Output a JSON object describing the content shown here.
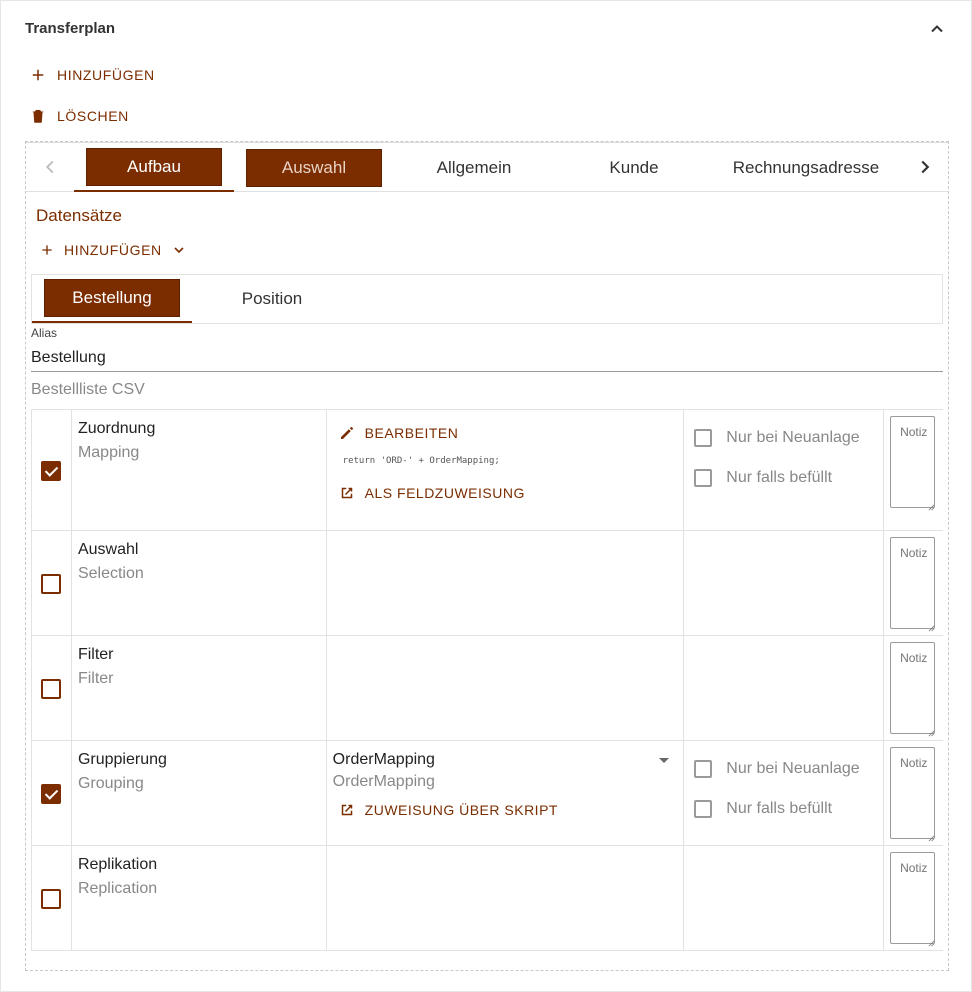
{
  "panel": {
    "title": "Transferplan",
    "add_label": "HINZUFÜGEN",
    "delete_label": "LÖSCHEN"
  },
  "tabs": [
    {
      "label": "Aufbau",
      "active": true
    },
    {
      "label": "Auswahl",
      "active": false
    },
    {
      "label": "Allgemein",
      "active": false
    },
    {
      "label": "Kunde",
      "active": false
    },
    {
      "label": "Rechnungsadresse",
      "active": false
    }
  ],
  "datasets": {
    "title": "Datensätze",
    "add_label": "HINZUFÜGEN",
    "subtabs": [
      {
        "label": "Bestellung",
        "active": true
      },
      {
        "label": "Position",
        "active": false
      }
    ],
    "alias_label": "Alias",
    "alias_value": "Bestellung",
    "description": "Bestellliste CSV"
  },
  "rows": [
    {
      "checked": true,
      "name": "Zuordnung",
      "sub": "Mapping",
      "edit_label": "BEARBEITEN",
      "code": "return 'ORD-' + OrderMapping;",
      "assign_label": "ALS FELDZUWEISUNG",
      "opt_new": "Nur bei Neuanlage",
      "opt_filled": "Nur falls befüllt",
      "note_placeholder": "Notiz"
    },
    {
      "checked": false,
      "name": "Auswahl",
      "sub": "Selection",
      "note_placeholder": "Notiz"
    },
    {
      "checked": false,
      "name": "Filter",
      "sub": "Filter",
      "note_placeholder": "Notiz"
    },
    {
      "checked": true,
      "name": "Gruppierung",
      "sub": "Grouping",
      "select_value": "OrderMapping",
      "select_sub": "OrderMapping",
      "assign_label": "ZUWEISUNG ÜBER SKRIPT",
      "opt_new": "Nur bei Neuanlage",
      "opt_filled": "Nur falls befüllt",
      "note_placeholder": "Notiz"
    },
    {
      "checked": false,
      "name": "Replikation",
      "sub": "Replication",
      "note_placeholder": "Notiz"
    }
  ],
  "colors": {
    "accent": "#7b2d00",
    "border": "#e2e2e2"
  }
}
